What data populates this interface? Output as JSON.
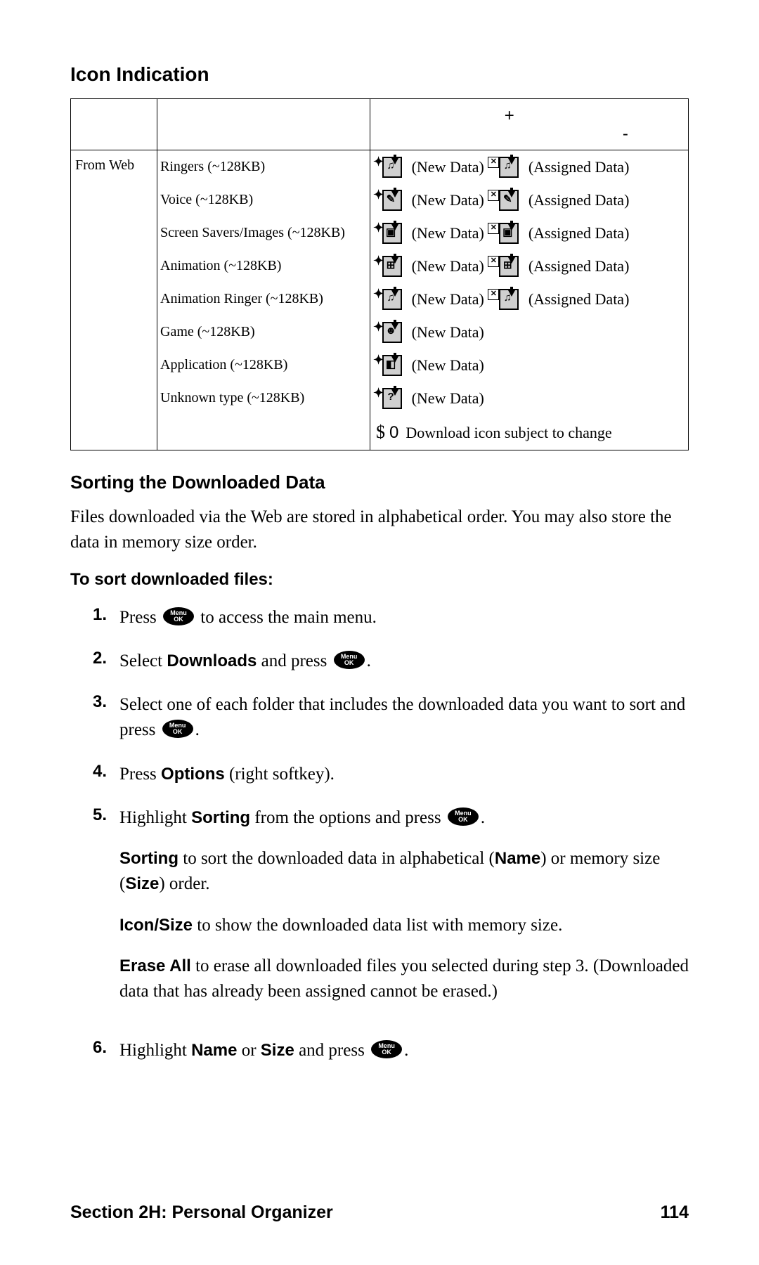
{
  "headings": {
    "icon_indication": "Icon Indication",
    "sorting": "Sorting the Downloaded Data",
    "to_sort": "To sort downloaded files:"
  },
  "table": {
    "header_plus": "+",
    "header_minus": "-",
    "source": "From Web",
    "rows": [
      {
        "type": "Ringers (~128KB)",
        "glyph": "♫",
        "new": " (New Data)",
        "assigned": " (Assigned Data)",
        "has_assigned": true
      },
      {
        "type": "Voice (~128KB)",
        "glyph": "✎",
        "new": " (New Data)",
        "assigned": " (Assigned Data)",
        "has_assigned": true
      },
      {
        "type": "Screen Savers/Images (~128KB)",
        "glyph": "▣",
        "new": " (New Data)",
        "assigned": " (Assigned Data)",
        "has_assigned": true
      },
      {
        "type": "Animation (~128KB)",
        "glyph": "⊞",
        "new": " (New Data)",
        "assigned": " (Assigned Data)",
        "has_assigned": true
      },
      {
        "type": "Animation Ringer (~128KB)",
        "glyph": "♫",
        "new": " (New Data)",
        "assigned": " (Assigned Data)",
        "has_assigned": true
      },
      {
        "type": "Game (~128KB)",
        "glyph": "☻",
        "new": " (New Data)",
        "has_assigned": false
      },
      {
        "type": "Application (~128KB)",
        "glyph": "◧",
        "new": " (New Data)",
        "has_assigned": false
      },
      {
        "type": "Unknown type (~128KB)",
        "glyph": "?",
        "new": " (New Data)",
        "has_assigned": false
      }
    ],
    "note_prefix_a": "$",
    "note_prefix_b": "0",
    "note": "Download icon subject to change"
  },
  "intro": "Files downloaded via the Web are stored in alphabetical order. You may also store the data in memory size order.",
  "steps": {
    "s1a": "Press ",
    "s1b": " to access the main menu.",
    "s2a": "Select ",
    "s2b": "Downloads",
    "s2c": " and press ",
    "s2d": ".",
    "s3a": "Select one of each folder that includes the downloaded data you want to sort and press ",
    "s3b": ".",
    "s4a": "Press ",
    "s4b": "Options",
    "s4c": " (right softkey).",
    "s5a": "Highlight ",
    "s5b": "Sorting",
    "s5c": " from the options and press ",
    "s5d": ".",
    "opt1a": "Sorting",
    "opt1b": " to sort the downloaded data in alphabetical (",
    "opt1c": "Name",
    "opt1d": ") or memory size (",
    "opt1e": "Size",
    "opt1f": ") order.",
    "opt2a": "Icon/Size",
    "opt2b": " to show the downloaded data list with memory size.",
    "opt3a": "Erase All",
    "opt3b": " to erase all downloaded files you selected during step 3. (Downloaded data that has already been assigned cannot be erased.)",
    "s6a": "Highlight ",
    "s6b": "Name",
    "s6c": " or ",
    "s6d": "Size",
    "s6e": " and press ",
    "s6f": "."
  },
  "nums": {
    "n1": "1.",
    "n2": "2.",
    "n3": "3.",
    "n4": "4.",
    "n5": "5.",
    "n6": "6."
  },
  "footer": {
    "section": "Section 2H: Personal Organizer",
    "page": "114"
  }
}
